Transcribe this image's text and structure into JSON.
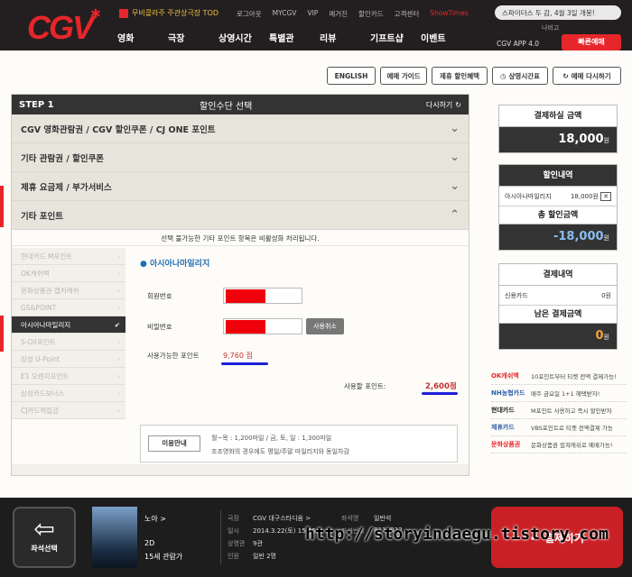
{
  "header": {
    "logo": "CGV",
    "promo": "무비콜라주 주관상극장 TOD",
    "utility": [
      "로그아웃",
      "MYCGV",
      "VIP",
      "메거진",
      "할인카드",
      "고객센터"
    ],
    "utility_accent": "ShowTimes",
    "search_placeholder": "스파이더스 두 감, 4월 3일 개봉!",
    "top_mini": "나비고",
    "nav": [
      "영화",
      "극장",
      "상영시간",
      "특별관",
      "리뷰",
      "기프트샵",
      "이벤트"
    ],
    "app": "CGV APP 4.0",
    "quick": "빠른예매"
  },
  "toolbar": {
    "english": "ENGLISH",
    "guide": "예매 가이드",
    "partner_discount": "제휴 할인혜택",
    "timetable": "상영시간표",
    "restart": "예매 다시하기"
  },
  "step": {
    "label": "STEP 1",
    "title": "할인수단 선택",
    "reset": "다시하기"
  },
  "accordions": [
    "CGV 영화관람권 / CGV 할인쿠폰 / CJ ONE 포인트",
    "기타 관람권 / 할인쿠폰",
    "제휴 요금제 / 부가서비스",
    "기타 포인트"
  ],
  "notice": "선택 불가능한 기타 포인트 항목은 비활성화 처리됩니다.",
  "point_list": [
    "현대카드 M포인트",
    "OK캐쉬백",
    "문화상품권 캡처캐쉬",
    "GS&POINT",
    "아시아나마일리지",
    "S-Oil포인트",
    "삼성 U-Point",
    "E1 오렌지포인트",
    "삼성카드보너스",
    "CJ카드적립금"
  ],
  "selected_index": 4,
  "detail": {
    "title": "아시아나마일리지",
    "member_label": "회원번호",
    "password_label": "비밀번호",
    "cancel": "사용취소",
    "available_label": "사용가능한 포인트",
    "available_value": "9,760 점",
    "used_label": "사용할 포인트:",
    "used_value": "2,600점",
    "guide_label": "이용안내",
    "guide_line1": "월~목 : 1,200마일 / 금, 토, 일 : 1,300마일",
    "guide_line2": "조조영화의 경우에도 평일/주말 마일리지와 동일차감"
  },
  "summary": {
    "pay_title": "결제하실 금액",
    "pay_amount": "18,000",
    "won": "원",
    "discount_title": "할인내역",
    "discount_item": "아시아나마일리지",
    "discount_item_amount": "18,000원",
    "total_discount_title": "총 할인금액",
    "total_discount": "-18,000",
    "payment_title": "결제내역",
    "payment_item": "신용카드",
    "payment_item_amount": "0원",
    "remaining_title": "남은 결제금액",
    "remaining": "0"
  },
  "promos": [
    {
      "label": "OK캐쉬백",
      "text": "10포인트부터 티켓 전액 결제가능!",
      "color": "#e6262b"
    },
    {
      "label": "NH농협카드",
      "text": "매주 금요일 1+1 혜택받자!",
      "color": "#2b5fa8"
    },
    {
      "label": "현대카드",
      "text": "M포인트 사용하고 즉시 할인받자",
      "color": "#222222"
    },
    {
      "label": "제휴카드",
      "text": "VBS포인트로 티켓 전액결제 가능",
      "color": "#2b5fa8"
    },
    {
      "label": "문화상품권",
      "text": "문화상품권 컬쳐캐쉬로 예매가능!",
      "color": "#e6262b"
    }
  ],
  "bottom": {
    "back": "좌석선택",
    "movie_title": "노아 >",
    "format": "2D",
    "rating": "15세 관람가",
    "theater_label": "극장",
    "theater": "CGV 대구스타디움 >",
    "date_label": "일시",
    "date": "2014.3.22(토) 15:25",
    "screen_label": "상영관",
    "screen": "9관",
    "people_label": "인원",
    "people": "일반 2명",
    "seat_class_label": "좌석명",
    "seat_class": "일반석",
    "seat_label": "좌석번호",
    "seat": "B11, B12",
    "pay": "결제하기",
    "watermark": "http://storyindaegu.tistory.com"
  }
}
